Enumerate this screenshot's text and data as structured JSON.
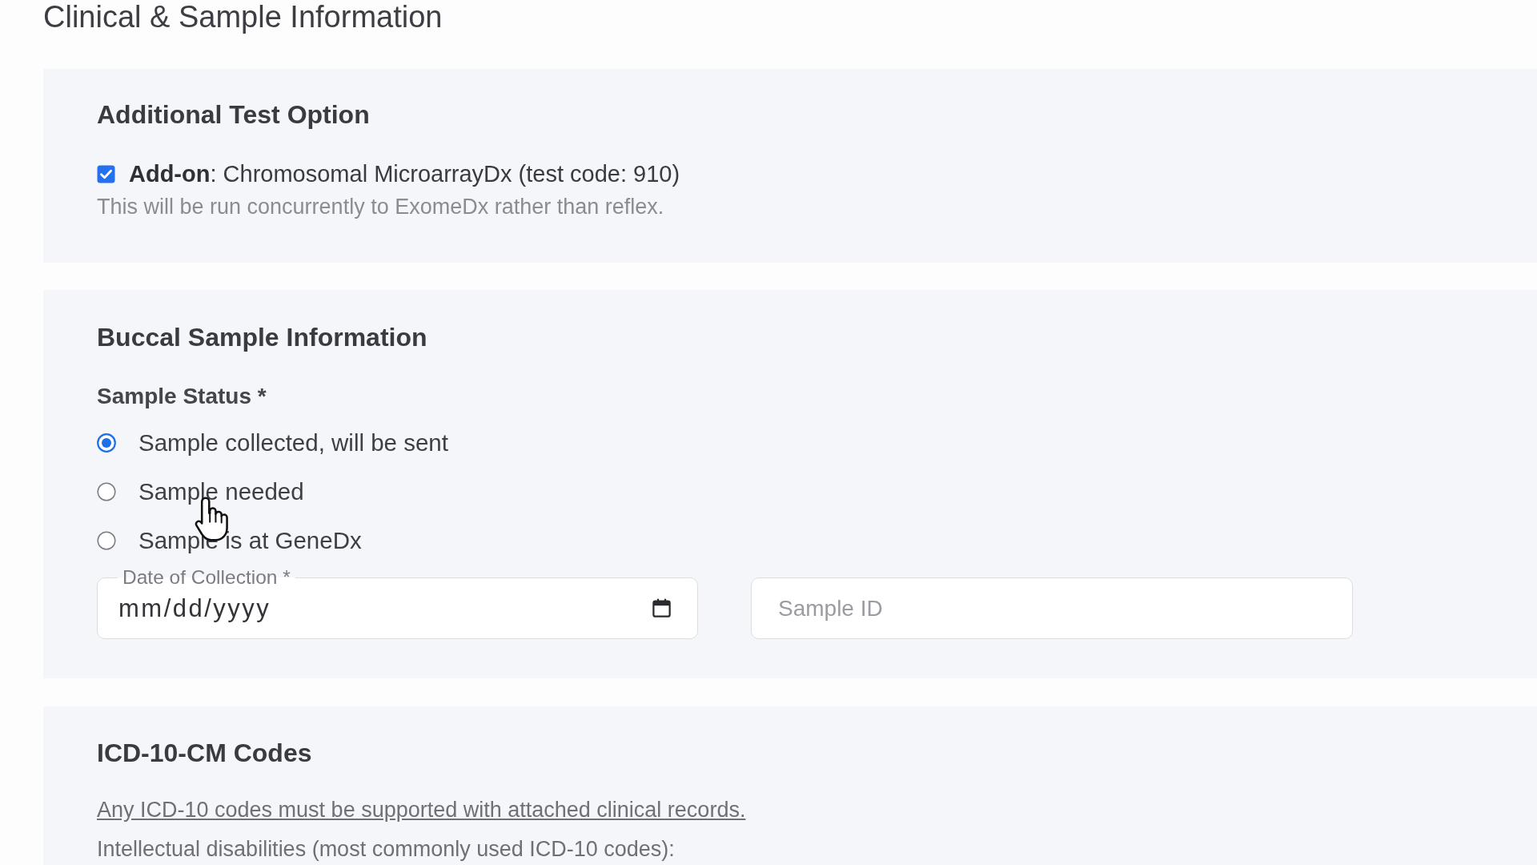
{
  "page": {
    "title": "Clinical & Sample Information"
  },
  "additional_test_option": {
    "title": "Additional Test Option",
    "options": [
      {
        "label": "**Add-on**: Chromosomal MicroarrayDx (test code: 910)",
        "checked": true,
        "note": "This will be run concurrently to ExomeDx rather than reflex."
      }
    ]
  },
  "buccal_sample": {
    "title": "Buccal Sample Information",
    "status": {
      "label": "Sample Status *",
      "options": [
        {
          "label": "Sample collected, will be sent",
          "selected": true
        },
        {
          "label": "Sample needed",
          "selected": false
        },
        {
          "label": "Sample is at GeneDx",
          "selected": false
        }
      ]
    },
    "fields": [
      {
        "kind": "date",
        "label": "Date of Collection *",
        "placeholder": "mm/dd/yyyy"
      },
      {
        "kind": "text",
        "placeholder": "Sample ID"
      }
    ]
  },
  "icd_codes": {
    "title": "ICD-10-CM Codes",
    "link": "Any ICD-10 codes must be supported with attached clinical records.",
    "subtitle": "Intellectual disabilities (most commonly used ICD-10 codes):"
  }
}
